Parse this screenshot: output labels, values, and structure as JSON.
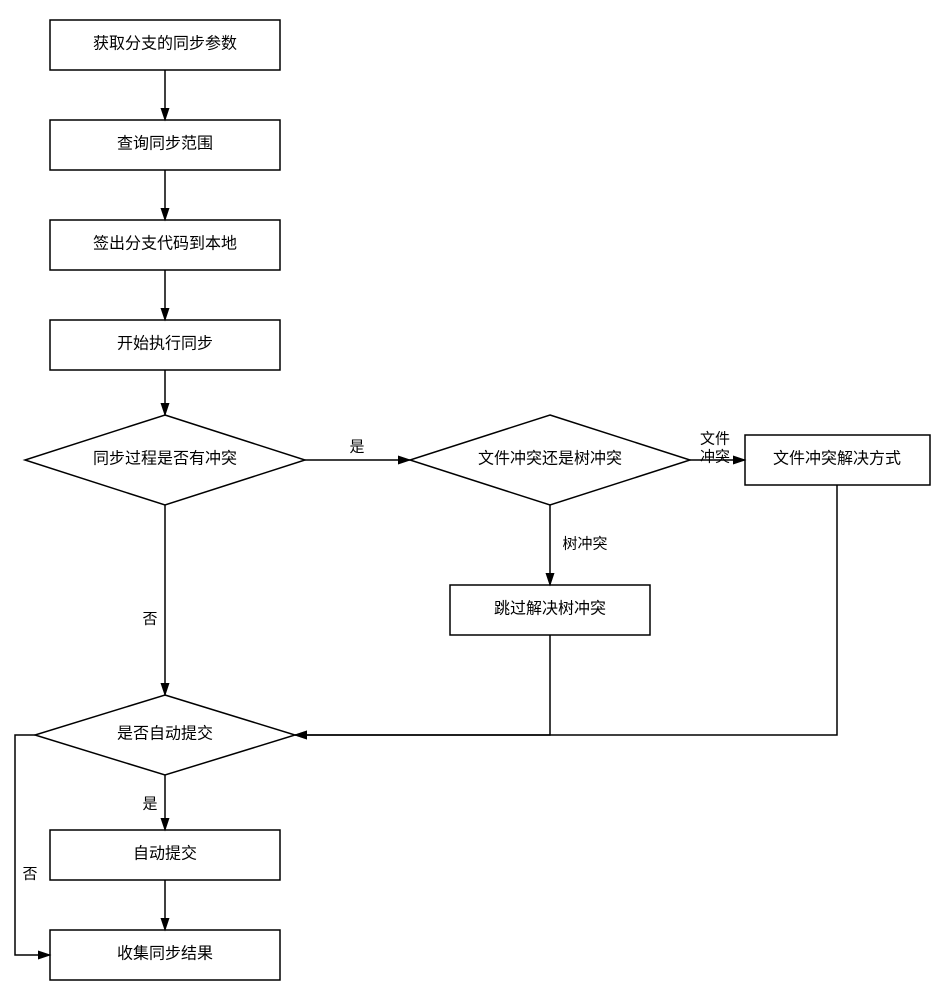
{
  "nodes": {
    "n1": "获取分支的同步参数",
    "n2": "查询同步范围",
    "n3": "签出分支代码到本地",
    "n4": "开始执行同步",
    "d1": "同步过程是否有冲突",
    "d2": "文件冲突还是树冲突",
    "n5": "文件冲突解决方式",
    "n6": "跳过解决树冲突",
    "d3": "是否自动提交",
    "n7": "自动提交",
    "n8": "收集同步结果"
  },
  "edge_labels": {
    "d1_yes": "是",
    "d1_no": "否",
    "d2_file_line1": "文件",
    "d2_file_line2": "冲突",
    "d2_tree": "树冲突",
    "d3_yes": "是",
    "d3_no": "否"
  },
  "chart_data": {
    "type": "flowchart",
    "nodes": [
      {
        "id": "n1",
        "kind": "process",
        "text": "获取分支的同步参数"
      },
      {
        "id": "n2",
        "kind": "process",
        "text": "查询同步范围"
      },
      {
        "id": "n3",
        "kind": "process",
        "text": "签出分支代码到本地"
      },
      {
        "id": "n4",
        "kind": "process",
        "text": "开始执行同步"
      },
      {
        "id": "d1",
        "kind": "decision",
        "text": "同步过程是否有冲突"
      },
      {
        "id": "d2",
        "kind": "decision",
        "text": "文件冲突还是树冲突"
      },
      {
        "id": "n5",
        "kind": "process",
        "text": "文件冲突解决方式"
      },
      {
        "id": "n6",
        "kind": "process",
        "text": "跳过解决树冲突"
      },
      {
        "id": "d3",
        "kind": "decision",
        "text": "是否自动提交"
      },
      {
        "id": "n7",
        "kind": "process",
        "text": "自动提交"
      },
      {
        "id": "n8",
        "kind": "process",
        "text": "收集同步结果"
      }
    ],
    "edges": [
      {
        "from": "n1",
        "to": "n2"
      },
      {
        "from": "n2",
        "to": "n3"
      },
      {
        "from": "n3",
        "to": "n4"
      },
      {
        "from": "n4",
        "to": "d1"
      },
      {
        "from": "d1",
        "to": "d2",
        "label": "是"
      },
      {
        "from": "d1",
        "to": "d3",
        "label": "否"
      },
      {
        "from": "d2",
        "to": "n5",
        "label": "文件冲突"
      },
      {
        "from": "d2",
        "to": "n6",
        "label": "树冲突"
      },
      {
        "from": "n5",
        "to": "d3"
      },
      {
        "from": "n6",
        "to": "d3"
      },
      {
        "from": "d3",
        "to": "n7",
        "label": "是"
      },
      {
        "from": "d3",
        "to": "n8",
        "label": "否"
      },
      {
        "from": "n7",
        "to": "n8"
      }
    ]
  }
}
